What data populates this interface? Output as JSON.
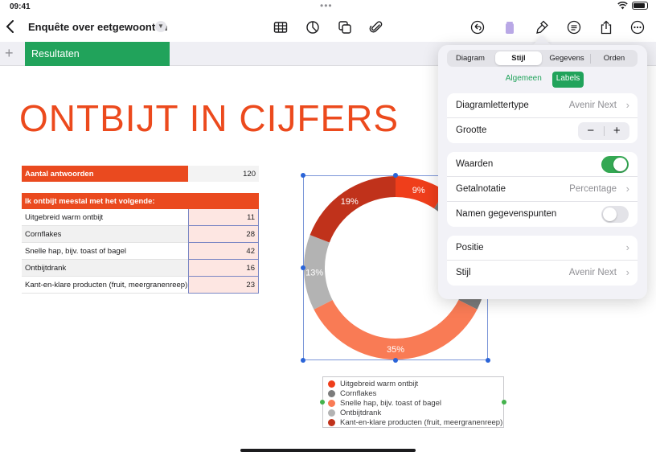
{
  "status": {
    "time": "09:41",
    "dots": "•••"
  },
  "toolbar": {
    "back_icon": "chevron-left-icon",
    "title": "Enquête over eetgewoonten",
    "icons": [
      "table-icon",
      "chart-icon",
      "shapes-icon",
      "paperclip-icon",
      "undo-icon",
      "trash-icon",
      "paintbrush-icon",
      "comment-icon",
      "share-icon",
      "more-icon"
    ]
  },
  "sheet": {
    "add_icon": "+",
    "tab_label": "Resultaten van...tbijtgewoonten"
  },
  "document": {
    "heading": "ONTBIJT IN CIJFERS",
    "summary": {
      "label": "Aantal antwoorden",
      "value": "120"
    },
    "table": {
      "header": "Ik ontbijt meestal met het volgende:",
      "rows": [
        {
          "label": "Uitgebreid warm ontbijt",
          "value": "11"
        },
        {
          "label": "Cornflakes",
          "value": "28"
        },
        {
          "label": "Snelle hap, bijv. toast of bagel",
          "value": "42"
        },
        {
          "label": "Ontbijtdrank",
          "value": "16"
        },
        {
          "label": "Kant-en-klare producten (fruit, meergranenreep)",
          "value": "23"
        }
      ]
    }
  },
  "chart_data": {
    "type": "pie",
    "categories": [
      "Uitgebreid warm ontbijt",
      "Cornflakes",
      "Snelle hap, bijv. toast of bagel",
      "Ontbijtdrank",
      "Kant-en-klare producten (fruit, meergranenreep)"
    ],
    "values": [
      11,
      28,
      42,
      16,
      23
    ],
    "labels": [
      "9%",
      "",
      "35%",
      "13%",
      "19%"
    ],
    "colors": [
      "#ef3e1b",
      "#7c7c7c",
      "#f97b55",
      "#b3b3b3",
      "#c0321b"
    ],
    "legend_position": "bottom"
  },
  "popover": {
    "tabs": [
      "Diagram",
      "Stijl",
      "Gegevens",
      "Orden"
    ],
    "active_tab": "Stijl",
    "subtabs": [
      "Algemeen",
      "Labels"
    ],
    "active_subtab": "Labels",
    "rows": {
      "font_label": "Diagramlettertype",
      "font_value": "Avenir Next",
      "size_label": "Grootte",
      "stepper_minus": "−",
      "stepper_plus": "+",
      "values_label": "Waarden",
      "values_on": true,
      "number_format_label": "Getalnotatie",
      "number_format_value": "Percentage",
      "point_names_label": "Namen gegevenspunten",
      "point_names_on": false,
      "position_label": "Positie",
      "style_label": "Stijl",
      "style_value": "Avenir Next"
    }
  }
}
